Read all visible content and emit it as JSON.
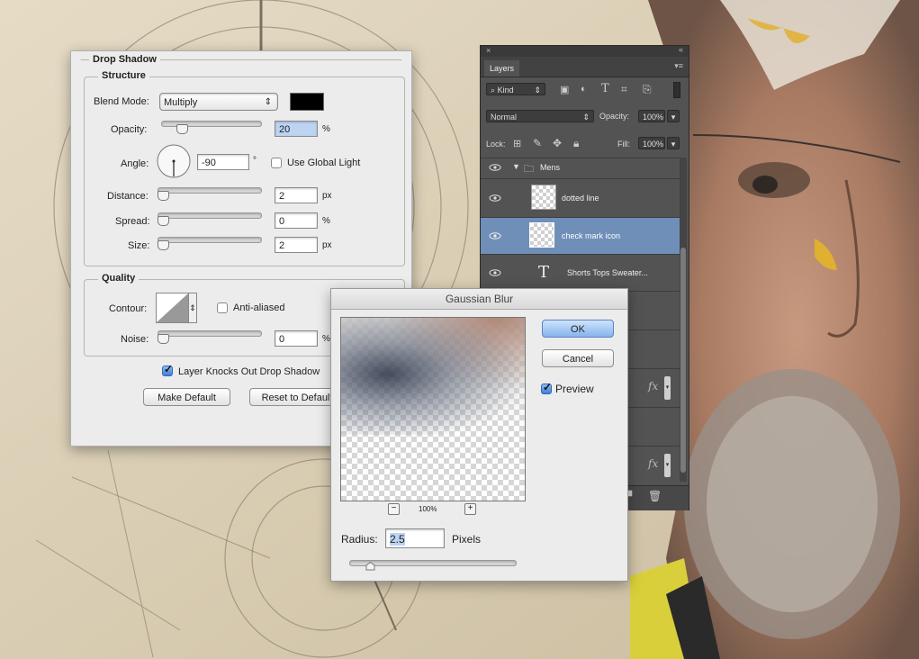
{
  "drop_shadow": {
    "section_title": "Drop Shadow",
    "structure": {
      "title": "Structure",
      "blend_mode_label": "Blend Mode:",
      "blend_mode_value": "Multiply",
      "shadow_color": "#000000",
      "opacity_label": "Opacity:",
      "opacity_value": "20",
      "opacity_unit": "%",
      "opacity_level": 0.2,
      "angle_label": "Angle:",
      "angle_value": "-90",
      "angle_unit": "°",
      "use_global_light_label": "Use Global Light",
      "use_global_light_checked": false,
      "distance_label": "Distance:",
      "distance_value": "2",
      "distance_unit": "px",
      "spread_label": "Spread:",
      "spread_value": "0",
      "spread_unit": "%",
      "size_label": "Size:",
      "size_value": "2",
      "size_unit": "px"
    },
    "quality": {
      "title": "Quality",
      "contour_label": "Contour:",
      "anti_aliased_label": "Anti-aliased",
      "anti_aliased_checked": false,
      "noise_label": "Noise:",
      "noise_value": "0",
      "noise_unit": "%"
    },
    "knockout_label": "Layer Knocks Out Drop Shadow",
    "knockout_checked": true,
    "make_default_label": "Make Default",
    "reset_default_label": "Reset to Default"
  },
  "layers_panel": {
    "tab_label": "Layers",
    "filter_kind": "Kind",
    "blend_mode": "Normal",
    "opacity_label": "Opacity:",
    "opacity_value": "100%",
    "lock_label": "Lock:",
    "fill_label": "Fill:",
    "fill_value": "100%",
    "group_name": "Mens",
    "layers": [
      {
        "name": "dotted line",
        "selected": false
      },
      {
        "name": "check mark icon",
        "selected": true
      },
      {
        "name": "Shorts Tops Sweater...",
        "selected": false
      }
    ],
    "type_layer_glyph": "T",
    "fx_label": "fx"
  },
  "gaussian_blur": {
    "title": "Gaussian Blur",
    "ok_label": "OK",
    "cancel_label": "Cancel",
    "preview_label": "Preview",
    "preview_checked": true,
    "zoom_value": "100%",
    "radius_label": "Radius:",
    "radius_value": "2.5",
    "radius_unit": "Pixels"
  },
  "colors": {
    "selection_blue": "#6f8fb8",
    "panel_dark": "#535353",
    "dialog_bg": "#ececec"
  }
}
